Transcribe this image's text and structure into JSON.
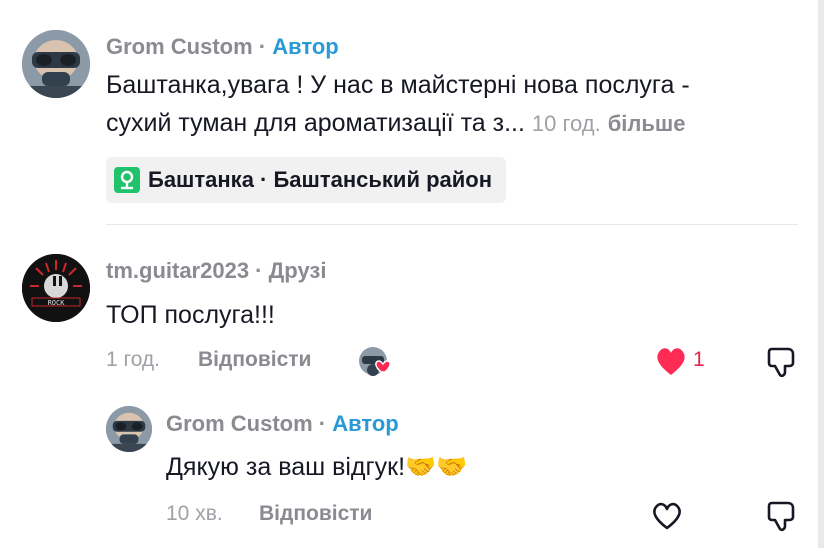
{
  "comments": [
    {
      "username": "Grom Custom",
      "separator": " · ",
      "badge": "Автор",
      "line1": "Баштанка,увага ! У нас в майстерні нова послуга -",
      "line2": "сухий туман для ароматизації та з...",
      "time": "10 год.",
      "more": "більше",
      "location": "Баштанка · Баштанський район"
    },
    {
      "username": "tm.guitar2023",
      "separator": " · ",
      "badge": "Друзі",
      "text": "ТОП послуга!!!",
      "time": "1 год.",
      "reply": "Відповісти",
      "likes": "1",
      "avatar_text": "ROCK"
    },
    {
      "username": "Grom Custom",
      "separator": " · ",
      "badge": "Автор",
      "text": "Дякую за ваш відгук!🤝🤝",
      "time": "10 хв.",
      "reply": "Відповісти"
    }
  ],
  "icons": {
    "like_filled_color": "#fe2c55",
    "location_pin_color": "#20c36b",
    "badge_color": "#2a9ad6"
  }
}
